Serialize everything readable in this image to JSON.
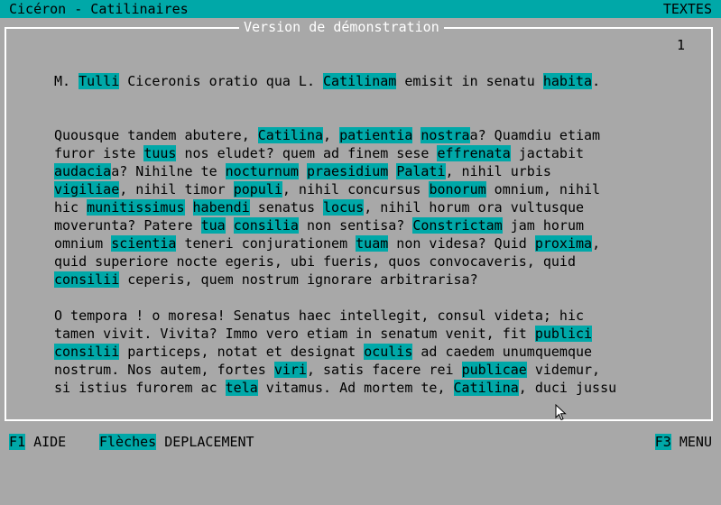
{
  "topbar": {
    "app_title": "Cicéron - Catilinaires",
    "mode": "TEXTES"
  },
  "frame": {
    "title": "Version de démonstration",
    "page_number": "1"
  },
  "text": {
    "lines": [
      [
        [
          "M. ",
          0
        ],
        [
          "Tulli",
          1
        ],
        [
          " Ciceronis oratio qua L. ",
          0
        ],
        [
          "Catilinam",
          1
        ],
        [
          " emisit in senatu ",
          0
        ],
        [
          "habita",
          1
        ],
        [
          ".",
          0
        ]
      ],
      [],
      [],
      [
        [
          "Quousque tandem abutere, ",
          0
        ],
        [
          "Catilina",
          1
        ],
        [
          ", ",
          0
        ],
        [
          "patientia",
          1
        ],
        [
          " ",
          0
        ],
        [
          "nostra",
          1
        ],
        [
          "a? Quamdiu etiam",
          0
        ]
      ],
      [
        [
          "furor iste ",
          0
        ],
        [
          "tuus",
          1
        ],
        [
          " nos eludet? quem ad finem sese ",
          0
        ],
        [
          "effrenata",
          1
        ],
        [
          " jactabit",
          0
        ]
      ],
      [
        [
          "audacia",
          1
        ],
        [
          "a? Nihilne te ",
          0
        ],
        [
          "nocturnum",
          1
        ],
        [
          " ",
          0
        ],
        [
          "praesidium",
          1
        ],
        [
          " ",
          0
        ],
        [
          "Palati",
          1
        ],
        [
          ", nihil urbis",
          0
        ]
      ],
      [
        [
          "vigiliae",
          1
        ],
        [
          ", nihil timor ",
          0
        ],
        [
          "populi",
          1
        ],
        [
          ", nihil concursus ",
          0
        ],
        [
          "bonorum",
          1
        ],
        [
          " omnium, nihil",
          0
        ]
      ],
      [
        [
          "hic ",
          0
        ],
        [
          "munitissimus",
          1
        ],
        [
          " ",
          0
        ],
        [
          "habendi",
          1
        ],
        [
          " senatus ",
          0
        ],
        [
          "locus",
          1
        ],
        [
          ", nihil horum ora vultusque",
          0
        ]
      ],
      [
        [
          "moverunta? Patere ",
          0
        ],
        [
          "tua",
          1
        ],
        [
          " ",
          0
        ],
        [
          "consilia",
          1
        ],
        [
          " non sentisa? ",
          0
        ],
        [
          "Constrictam",
          1
        ],
        [
          " jam horum",
          0
        ]
      ],
      [
        [
          "omnium ",
          0
        ],
        [
          "scientia",
          1
        ],
        [
          " teneri conjurationem ",
          0
        ],
        [
          "tuam",
          1
        ],
        [
          " non videsa? Quid ",
          0
        ],
        [
          "proxima",
          1
        ],
        [
          ",",
          0
        ]
      ],
      [
        [
          "quid superiore nocte egeris, ubi fueris, quos convocaveris, quid",
          0
        ]
      ],
      [
        [
          "consilii",
          1
        ],
        [
          " ceperis, quem nostrum ignorare arbitrarisa?",
          0
        ]
      ],
      [],
      [
        [
          "O tempora ! o moresa! Senatus haec intellegit, consul videta; hic",
          0
        ]
      ],
      [
        [
          "tamen vivit. Vivita? Immo vero etiam in senatum venit, fit ",
          0
        ],
        [
          "publici",
          1
        ]
      ],
      [
        [
          "consilii",
          1
        ],
        [
          " particeps, notat et designat ",
          0
        ],
        [
          "oculis",
          1
        ],
        [
          " ad caedem unumquemque",
          0
        ]
      ],
      [
        [
          "nostrum. Nos autem, fortes ",
          0
        ],
        [
          "viri",
          1
        ],
        [
          ", satis facere rei ",
          0
        ],
        [
          "publicae",
          1
        ],
        [
          " videmur,",
          0
        ]
      ],
      [
        [
          "si istius furorem ac ",
          0
        ],
        [
          "tela",
          1
        ],
        [
          " vitamus. Ad mortem te, ",
          0
        ],
        [
          "Catilina",
          1
        ],
        [
          ", duci jussu",
          0
        ]
      ]
    ]
  },
  "bottombar": {
    "f1_key": "F1",
    "f1_label": " AIDE",
    "arrows_key": "Flèches",
    "arrows_label": " DEPLACEMENT",
    "f3_key": "F3",
    "f3_label": " MENU"
  },
  "colors": {
    "background": "#a8a8a8",
    "highlight": "#00a8a8",
    "frame": "#ffffff"
  },
  "icons": {
    "cursor": "mouse-pointer-icon"
  }
}
